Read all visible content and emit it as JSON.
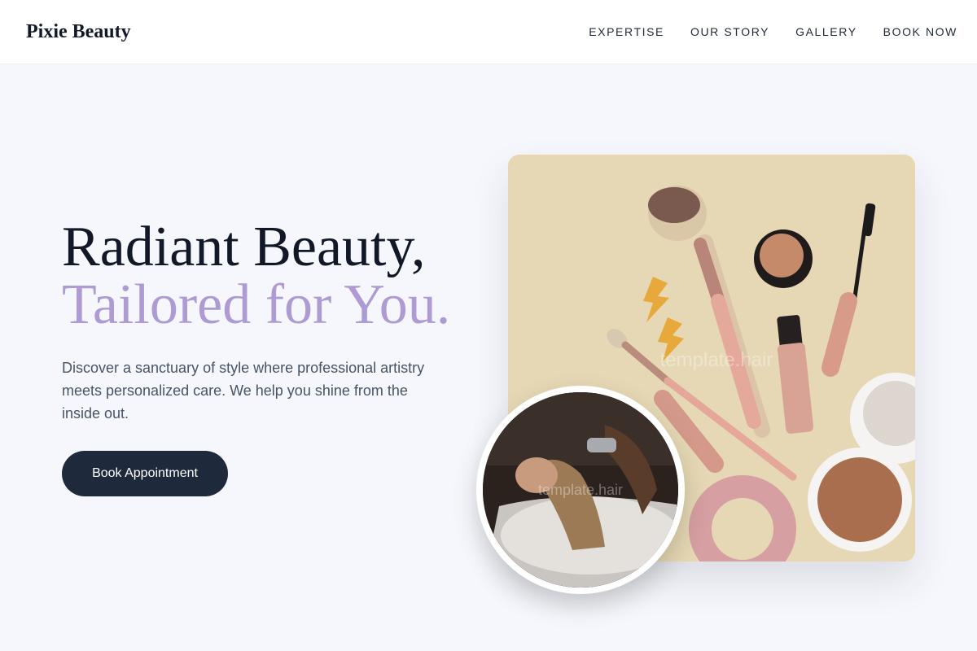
{
  "brand": {
    "name": "Pixie Beauty"
  },
  "nav": {
    "items": [
      {
        "label": "EXPERTISE"
      },
      {
        "label": "OUR STORY"
      },
      {
        "label": "GALLERY"
      },
      {
        "label": "BOOK NOW"
      }
    ]
  },
  "hero": {
    "title_line1": "Radiant Beauty,",
    "title_line2": "Tailored for You.",
    "description": "Discover a sanctuary of style where professional artistry meets personalized care. We help you shine from the inside out.",
    "cta_label": "Book Appointment"
  },
  "images": {
    "main_watermark": "template.hair",
    "circle_watermark": "template.hair"
  },
  "colors": {
    "page_background": "#f6f7fc",
    "heading_dark": "#111827",
    "heading_accent": "#ae9bd3",
    "button": "#1e293b",
    "card_background": "#e6d8b4"
  }
}
